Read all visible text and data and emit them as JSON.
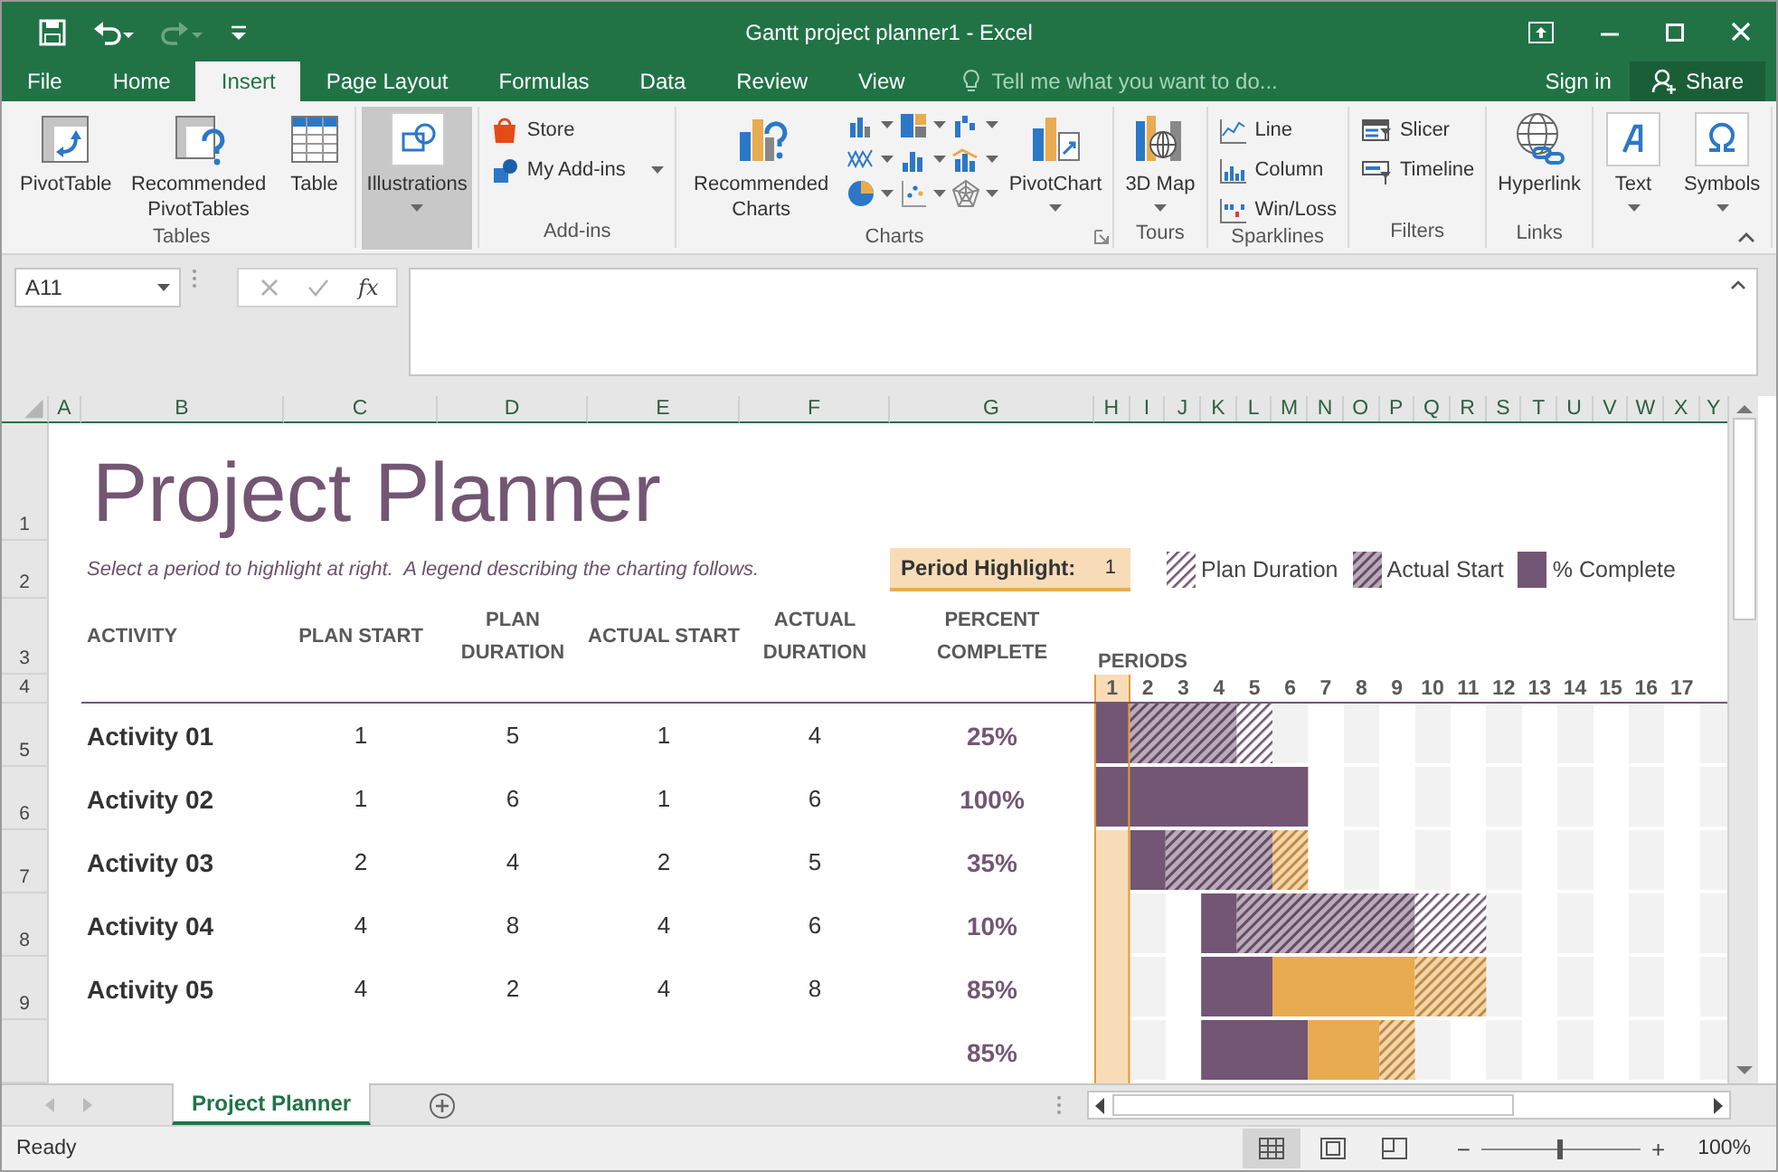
{
  "window": {
    "title": "Gantt project planner1 - Excel"
  },
  "quick_access": [
    {
      "kind": "save",
      "disabled": false
    },
    {
      "kind": "undo",
      "disabled": false
    },
    {
      "kind": "redo",
      "disabled": true
    },
    {
      "kind": "customize",
      "disabled": false
    }
  ],
  "tabs": [
    {
      "label": "File",
      "selected": false
    },
    {
      "label": "Home",
      "selected": false
    },
    {
      "label": "Insert",
      "selected": true
    },
    {
      "label": "Page Layout",
      "selected": false
    },
    {
      "label": "Formulas",
      "selected": false
    },
    {
      "label": "Data",
      "selected": false
    },
    {
      "label": "Review",
      "selected": false
    },
    {
      "label": "View",
      "selected": false
    }
  ],
  "tell_me": {
    "placeholder": "Tell me what you want to do..."
  },
  "account": {
    "sign_in": "Sign in",
    "share": "Share"
  },
  "ribbon": {
    "groups": [
      {
        "label": "Tables",
        "items": [
          {
            "label": "PivotTable",
            "kind": "large",
            "highlighted": false
          },
          {
            "label": "Recommended PivotTables",
            "kind": "large",
            "highlighted": false
          },
          {
            "label": "Table",
            "kind": "large",
            "highlighted": false
          }
        ]
      },
      {
        "items": [
          {
            "label": "Illustrations",
            "kind": "large_menu",
            "highlighted": true
          }
        ]
      },
      {
        "label": "Add-ins",
        "items": [
          {
            "label": "Store",
            "kind": "small",
            "highlighted": false
          },
          {
            "label": "My Add-ins",
            "kind": "small_menu",
            "highlighted": false
          }
        ]
      },
      {
        "label": "Charts",
        "launcher": true,
        "items": [
          {
            "label": "Recommended Charts",
            "kind": "large",
            "highlighted": false
          },
          {
            "kind": "gallery",
            "highlighted": false
          },
          {
            "kind": "gallery",
            "highlighted": false
          },
          {
            "kind": "gallery",
            "highlighted": false
          },
          {
            "kind": "gallery",
            "highlighted": false
          },
          {
            "kind": "gallery",
            "highlighted": false
          },
          {
            "kind": "gallery",
            "highlighted": false
          },
          {
            "kind": "gallery",
            "highlighted": false
          },
          {
            "kind": "gallery",
            "highlighted": false
          },
          {
            "kind": "gallery",
            "highlighted": false
          },
          {
            "label": "PivotChart",
            "kind": "large_menu",
            "highlighted": false
          }
        ]
      },
      {
        "label": "Tours",
        "items": [
          {
            "label": "3D Map",
            "kind": "large_menu",
            "highlighted": false
          }
        ]
      },
      {
        "label": "Sparklines",
        "items": [
          {
            "label": "Line",
            "kind": "small",
            "highlighted": false
          },
          {
            "label": "Column",
            "kind": "small",
            "highlighted": false
          },
          {
            "label": "Win/Loss",
            "kind": "small",
            "highlighted": false
          }
        ]
      },
      {
        "label": "Filters",
        "items": [
          {
            "label": "Slicer",
            "kind": "small",
            "highlighted": false
          },
          {
            "label": "Timeline",
            "kind": "small",
            "highlighted": false
          }
        ]
      },
      {
        "label": "Links",
        "items": [
          {
            "label": "Hyperlink",
            "kind": "large",
            "highlighted": false
          }
        ]
      },
      {
        "items": [
          {
            "label": "Text",
            "kind": "large_menu",
            "highlighted": false
          }
        ]
      },
      {
        "items": [
          {
            "label": "Symbols",
            "kind": "large_menu",
            "highlighted": false
          }
        ]
      }
    ]
  },
  "formula_bar": {
    "name_box": "A11",
    "function_button": "fx"
  },
  "column_headers": [
    "A",
    "B",
    "C",
    "D",
    "E",
    "F",
    "G",
    "H",
    "I",
    "J",
    "K",
    "L",
    "M",
    "N",
    "O",
    "P",
    "Q",
    "R",
    "S",
    "T",
    "U",
    "V",
    "W",
    "X",
    "Y"
  ],
  "row_headers": [
    "1",
    "2",
    "3",
    "4",
    "5",
    "6",
    "7",
    "8",
    "9"
  ],
  "sheet": {
    "title": "Project Planner",
    "subtitle": "Select a period to highlight at right.  A legend describing the charting follows.",
    "period_highlight": {
      "label": "Period Highlight:",
      "value": "1"
    },
    "legend": [
      {
        "label": "Plan Duration",
        "kind": "plan"
      },
      {
        "label": "Actual Start",
        "kind": "actual"
      },
      {
        "label": "% Complete",
        "kind": "complete"
      }
    ],
    "columns": [
      "ACTIVITY",
      "PLAN START",
      "PLAN DURATION",
      "ACTUAL START",
      "ACTUAL DURATION",
      "PERCENT COMPLETE"
    ],
    "periods_label": "PERIODS",
    "periods": [
      {
        "label": "1",
        "selected": true
      },
      {
        "label": "2",
        "selected": false
      },
      {
        "label": "3",
        "selected": false
      },
      {
        "label": "4",
        "selected": false
      },
      {
        "label": "5",
        "selected": false
      },
      {
        "label": "6",
        "selected": false
      },
      {
        "label": "7",
        "selected": false
      },
      {
        "label": "8",
        "selected": false
      },
      {
        "label": "9",
        "selected": false
      },
      {
        "label": "10",
        "selected": false
      },
      {
        "label": "11",
        "selected": false
      },
      {
        "label": "12",
        "selected": false
      },
      {
        "label": "13",
        "selected": false
      },
      {
        "label": "14",
        "selected": false
      },
      {
        "label": "15",
        "selected": false
      },
      {
        "label": "16",
        "selected": false
      },
      {
        "label": "17",
        "selected": false
      }
    ],
    "rows": [
      {
        "activity": "Activity 01",
        "plan_start": "1",
        "plan_duration": "5",
        "actual_start": "1",
        "actual_duration": "4",
        "percent_complete": "25%",
        "timeline": [
          {
            "kind": "complete"
          },
          {
            "kind": "actual"
          },
          {
            "kind": "actual"
          },
          {
            "kind": "actual"
          },
          {
            "kind": "plan"
          }
        ]
      },
      {
        "activity": "Activity 02",
        "plan_start": "1",
        "plan_duration": "6",
        "actual_start": "1",
        "actual_duration": "6",
        "percent_complete": "100%",
        "timeline": [
          {
            "kind": "complete"
          },
          {
            "kind": "complete"
          },
          {
            "kind": "complete"
          },
          {
            "kind": "complete"
          },
          {
            "kind": "complete"
          },
          {
            "kind": "complete"
          }
        ]
      },
      {
        "activity": "Activity 03",
        "plan_start": "2",
        "plan_duration": "4",
        "actual_start": "2",
        "actual_duration": "5",
        "percent_complete": "35%",
        "timeline": [
          {
            "kind": "none"
          },
          {
            "kind": "complete"
          },
          {
            "kind": "actual"
          },
          {
            "kind": "actual"
          },
          {
            "kind": "actual"
          },
          {
            "kind": "actual_beyond"
          }
        ]
      },
      {
        "activity": "Activity 04",
        "plan_start": "4",
        "plan_duration": "8",
        "actual_start": "4",
        "actual_duration": "6",
        "percent_complete": "10%",
        "timeline": [
          {
            "kind": "none"
          },
          {
            "kind": "none"
          },
          {
            "kind": "none"
          },
          {
            "kind": "complete"
          },
          {
            "kind": "actual"
          },
          {
            "kind": "actual"
          },
          {
            "kind": "actual"
          },
          {
            "kind": "actual"
          },
          {
            "kind": "actual"
          },
          {
            "kind": "plan"
          },
          {
            "kind": "plan"
          }
        ]
      },
      {
        "activity": "Activity 05",
        "plan_start": "4",
        "plan_duration": "2",
        "actual_start": "4",
        "actual_duration": "8",
        "percent_complete": "85%",
        "timeline": [
          {
            "kind": "none"
          },
          {
            "kind": "none"
          },
          {
            "kind": "none"
          },
          {
            "kind": "complete"
          },
          {
            "kind": "complete"
          },
          {
            "kind": "complete_beyond"
          },
          {
            "kind": "complete_beyond"
          },
          {
            "kind": "complete_beyond"
          },
          {
            "kind": "complete_beyond"
          },
          {
            "kind": "actual_beyond"
          },
          {
            "kind": "actual_beyond"
          }
        ]
      },
      {
        "percent_complete": "85%",
        "timeline": [
          {
            "kind": "none"
          },
          {
            "kind": "none"
          },
          {
            "kind": "none"
          },
          {
            "kind": "complete"
          },
          {
            "kind": "complete"
          },
          {
            "kind": "complete"
          },
          {
            "kind": "complete_beyond"
          },
          {
            "kind": "complete_beyond"
          },
          {
            "kind": "actual_beyond"
          }
        ]
      }
    ]
  },
  "sheet_tabs": [
    {
      "label": "Project Planner",
      "selected": true
    }
  ],
  "views": [
    {
      "kind": "normal",
      "selected": true
    },
    {
      "kind": "page_layout",
      "selected": false
    },
    {
      "kind": "page_break",
      "selected": false
    }
  ],
  "status_bar": {
    "status": "Ready",
    "zoom": {
      "minus": "−",
      "plus": "+",
      "level": 0.5,
      "reading": "100%"
    }
  }
}
